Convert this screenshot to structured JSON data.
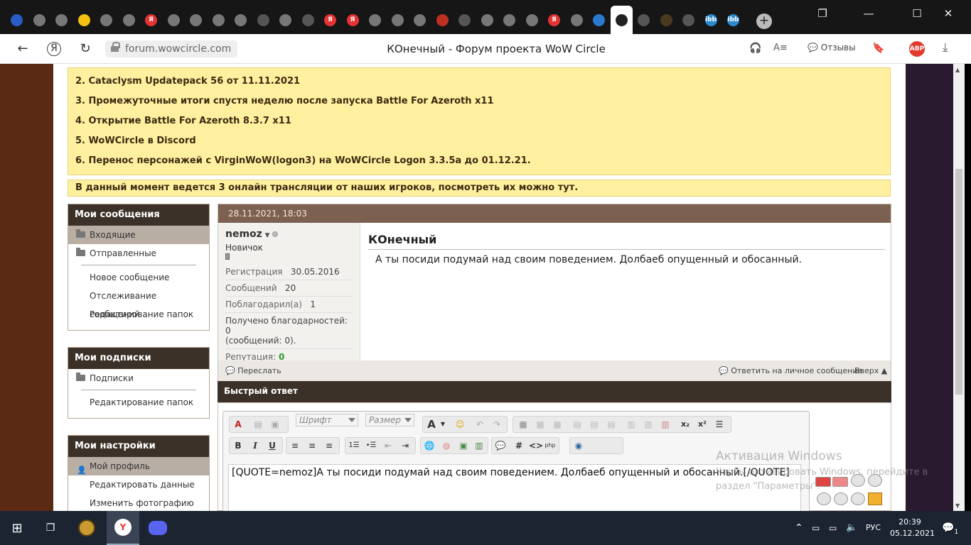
{
  "browser": {
    "tabs": [
      {
        "icon": "flag-icon",
        "color": "#2a5cc8"
      },
      {
        "icon": "penguin-icon",
        "color": "#777"
      },
      {
        "icon": "penguin-icon",
        "color": "#777"
      },
      {
        "icon": "play-icon",
        "color": "#f5c010"
      },
      {
        "icon": "penguin-icon",
        "color": "#777"
      },
      {
        "icon": "penguin-icon",
        "color": "#777"
      },
      {
        "icon": "yandex-icon",
        "color": "#e53333",
        "text": "Я"
      },
      {
        "icon": "penguin-icon",
        "color": "#777"
      },
      {
        "icon": "penguin-icon",
        "color": "#777"
      },
      {
        "icon": "penguin-icon",
        "color": "#777"
      },
      {
        "icon": "penguin-icon",
        "color": "#777"
      },
      {
        "icon": "page-icon",
        "color": "#555"
      },
      {
        "icon": "penguin-icon",
        "color": "#777"
      },
      {
        "icon": "page-icon",
        "color": "#555"
      },
      {
        "icon": "yandex-icon",
        "color": "#e53333",
        "text": "Я"
      },
      {
        "icon": "yandex-icon",
        "color": "#e53333",
        "text": "Я"
      },
      {
        "icon": "penguin-icon",
        "color": "#777"
      },
      {
        "icon": "penguin-icon",
        "color": "#777"
      },
      {
        "icon": "penguin-icon",
        "color": "#777"
      },
      {
        "icon": "red-page-icon",
        "color": "#c03020"
      },
      {
        "icon": "mask-icon",
        "color": "#555"
      },
      {
        "icon": "mask-icon",
        "color": "#777"
      },
      {
        "icon": "penguin-icon",
        "color": "#777"
      },
      {
        "icon": "penguin-icon",
        "color": "#777"
      },
      {
        "icon": "yandex-icon",
        "color": "#e53333",
        "text": "Я"
      },
      {
        "icon": "penguin-icon",
        "color": "#777"
      },
      {
        "icon": "pause-icon",
        "color": "#2a7ad0"
      },
      {
        "icon": "wowcircle-icon",
        "color": "#222",
        "active": true
      },
      {
        "icon": "wowcircle-icon",
        "color": "#555"
      },
      {
        "icon": "wow-icon",
        "color": "#4a3a20"
      },
      {
        "icon": "wowcircle-icon",
        "color": "#555"
      },
      {
        "icon": "ibb-icon",
        "color": "#2a8ad0",
        "text": "ibb"
      },
      {
        "icon": "ibb-icon",
        "color": "#2a8ad0",
        "text": "ibb"
      }
    ],
    "url": "forum.wowcircle.com",
    "page_title": "КОнечный - Форум проекта WoW Circle",
    "reviews_label": "Отзывы",
    "abp_label": "ABP"
  },
  "notices": [
    "2. Cataclysm Updatepack 56 от 11.11.2021",
    "3. Промежуточные итоги спустя неделю после запуска Battle For Azeroth x11",
    "4. Открытие Battle For Azeroth 8.3.7 x11",
    "5. WoWCircle в Discord",
    "6. Перенос персонажей с VirginWoW(logon3) на WoWCircle Logon 3.3.5a до 01.12.21."
  ],
  "stream_notice": "В данный момент ведется 3 онлайн трансляции от наших игроков, посмотреть их можно тут.",
  "sidebar": {
    "messages": {
      "title": "Мои сообщения",
      "inbox": "Входящие",
      "sent": "Отправленные",
      "new_message": "Новое сообщение",
      "tracking": "Отслеживание сообщений",
      "edit_folders": "Редактирование папок"
    },
    "subscriptions": {
      "title": "Мои подписки",
      "subs": "Подписки",
      "edit_folders": "Редактирование папок"
    },
    "settings": {
      "title": "Мои настройки",
      "profile": "Мой профиль",
      "edit_data": "Редактировать данные",
      "change_photo": "Изменить фотографию"
    }
  },
  "post": {
    "date": "28.11.2021, 18:03",
    "author": "nemoz",
    "rank": "Новичок",
    "reg_label": "Регистрация",
    "reg_value": "30.05.2016",
    "posts_label": "Сообщений",
    "posts_value": "20",
    "thanked_label": "Поблагодарил(а)",
    "thanked_value": "1",
    "received_thanks": "Получено благодарностей: 0",
    "received_thanks_posts": "(сообщений: 0).",
    "rep_label": "Репутация:",
    "rep_value": "0",
    "title": "КОнечный",
    "text": "А ты посиди подумай над своим поведением. Долбаеб опущенный и обосанный.",
    "forward": "Переслать",
    "reply_private": "Ответить на личное сообщение",
    "up": "Вверх"
  },
  "quick_reply": {
    "title": "Быстрый ответ",
    "font_placeholder": "Шрифт",
    "size_placeholder": "Размер",
    "text": "[QUOTE=nemoz]А ты посиди подумай над своим поведением. Долбаеб опущенный и обосанный.[/QUOTE]"
  },
  "activation": {
    "line1": "Активация Windows",
    "line2": "Чтобы активировать Windows, перейдите в раздел \"Параметры\"."
  },
  "taskbar": {
    "lang": "РУС",
    "time": "20:39",
    "date": "05.12.2021",
    "notif_count": "1"
  }
}
